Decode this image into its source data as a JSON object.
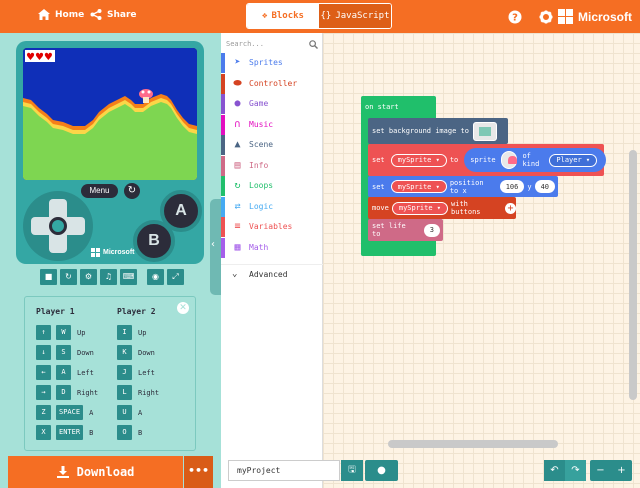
{
  "header": {
    "home_label": "Home",
    "share_label": "Share",
    "tab_blocks": "Blocks",
    "tab_javascript": "JavaScript",
    "brand": "Microsoft"
  },
  "simulator": {
    "menu_label": "Menu",
    "a_label": "A",
    "b_label": "B",
    "brand": "Microsoft",
    "hearts": "♥♥♥"
  },
  "keys": {
    "player1": "Player 1",
    "player2": "Player 2",
    "p1": [
      {
        "key": "↑",
        "alt": "W",
        "label": "Up"
      },
      {
        "key": "↓",
        "alt": "S",
        "label": "Down"
      },
      {
        "key": "←",
        "alt": "A",
        "label": "Left"
      },
      {
        "key": "→",
        "alt": "D",
        "label": "Right"
      },
      {
        "key": "Z",
        "alt": "SPACE",
        "label": "A"
      },
      {
        "key": "X",
        "alt": "ENTER",
        "label": "B"
      }
    ],
    "p2": [
      {
        "key": "I",
        "label": "Up"
      },
      {
        "key": "K",
        "label": "Down"
      },
      {
        "key": "J",
        "label": "Left"
      },
      {
        "key": "L",
        "label": "Right"
      },
      {
        "key": "U",
        "label": "A"
      },
      {
        "key": "O",
        "label": "B"
      }
    ]
  },
  "download_label": "Download",
  "toolbox": {
    "search_placeholder": "Search...",
    "categories": [
      {
        "label": "Sprites",
        "color": "#4b7bec",
        "icon": "plane-icon"
      },
      {
        "label": "Controller",
        "color": "#d54322",
        "icon": "gamepad-icon"
      },
      {
        "label": "Game",
        "color": "#8854d0",
        "icon": "circle-icon"
      },
      {
        "label": "Music",
        "color": "#e30fc0",
        "icon": "headphones-icon"
      },
      {
        "label": "Scene",
        "color": "#4b6584",
        "icon": "tree-icon"
      },
      {
        "label": "Info",
        "color": "#cf6a87",
        "icon": "id-card-icon"
      },
      {
        "label": "Loops",
        "color": "#20bf6b",
        "icon": "refresh-icon"
      },
      {
        "label": "Logic",
        "color": "#45aaf2",
        "icon": "shuffle-icon"
      },
      {
        "label": "Variables",
        "color": "#ee5253",
        "icon": "list-icon"
      },
      {
        "label": "Math",
        "color": "#a55eea",
        "icon": "calculator-icon"
      }
    ],
    "advanced_label": "Advanced"
  },
  "blocks": {
    "on_start": "on start",
    "set_bg": "set background image to",
    "set": "set",
    "my_sprite": "mySprite",
    "to": "to",
    "sprite": "sprite",
    "of_kind": "of kind",
    "player": "Player",
    "set_pos": "set",
    "position_to_x": "position to x",
    "x_val": "106",
    "y_label": "y",
    "y_val": "40",
    "move": "move",
    "with_buttons": "with buttons",
    "set_life": "set life to",
    "life_val": "3"
  },
  "project_name": "myProject"
}
